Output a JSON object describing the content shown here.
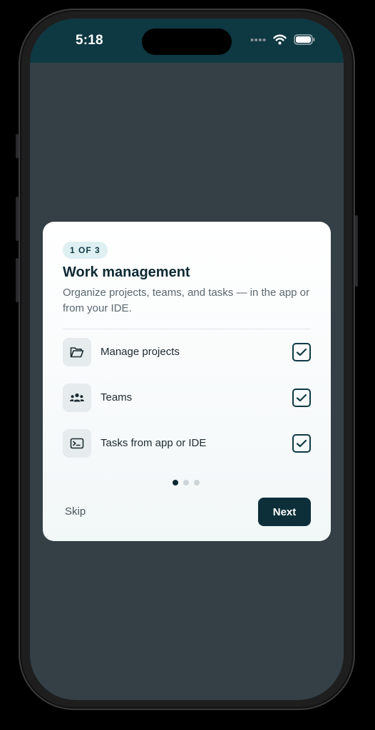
{
  "status_bar": {
    "time": "5:18",
    "icons": [
      "signal-dots-icon",
      "wifi-icon",
      "battery-icon"
    ]
  },
  "onboarding": {
    "step_label": "1 OF 3",
    "title": "Work management",
    "description": "Organize projects, teams, and tasks — in the app or from your IDE.",
    "features": [
      {
        "label": "Manage projects",
        "icon": "folder-open-icon",
        "checked": true
      },
      {
        "label": "Teams",
        "icon": "people-group-icon",
        "checked": true
      },
      {
        "label": "Tasks from app or IDE",
        "icon": "terminal-icon",
        "checked": true
      }
    ],
    "pagination": {
      "current": 1,
      "total": 3
    },
    "skip_label": "Skip",
    "next_label": "Next"
  },
  "colors": {
    "accent": "#0d2f39",
    "status_bar": "#0e3842",
    "backdrop": "#344046",
    "badge_bg": "#dff0f2"
  }
}
